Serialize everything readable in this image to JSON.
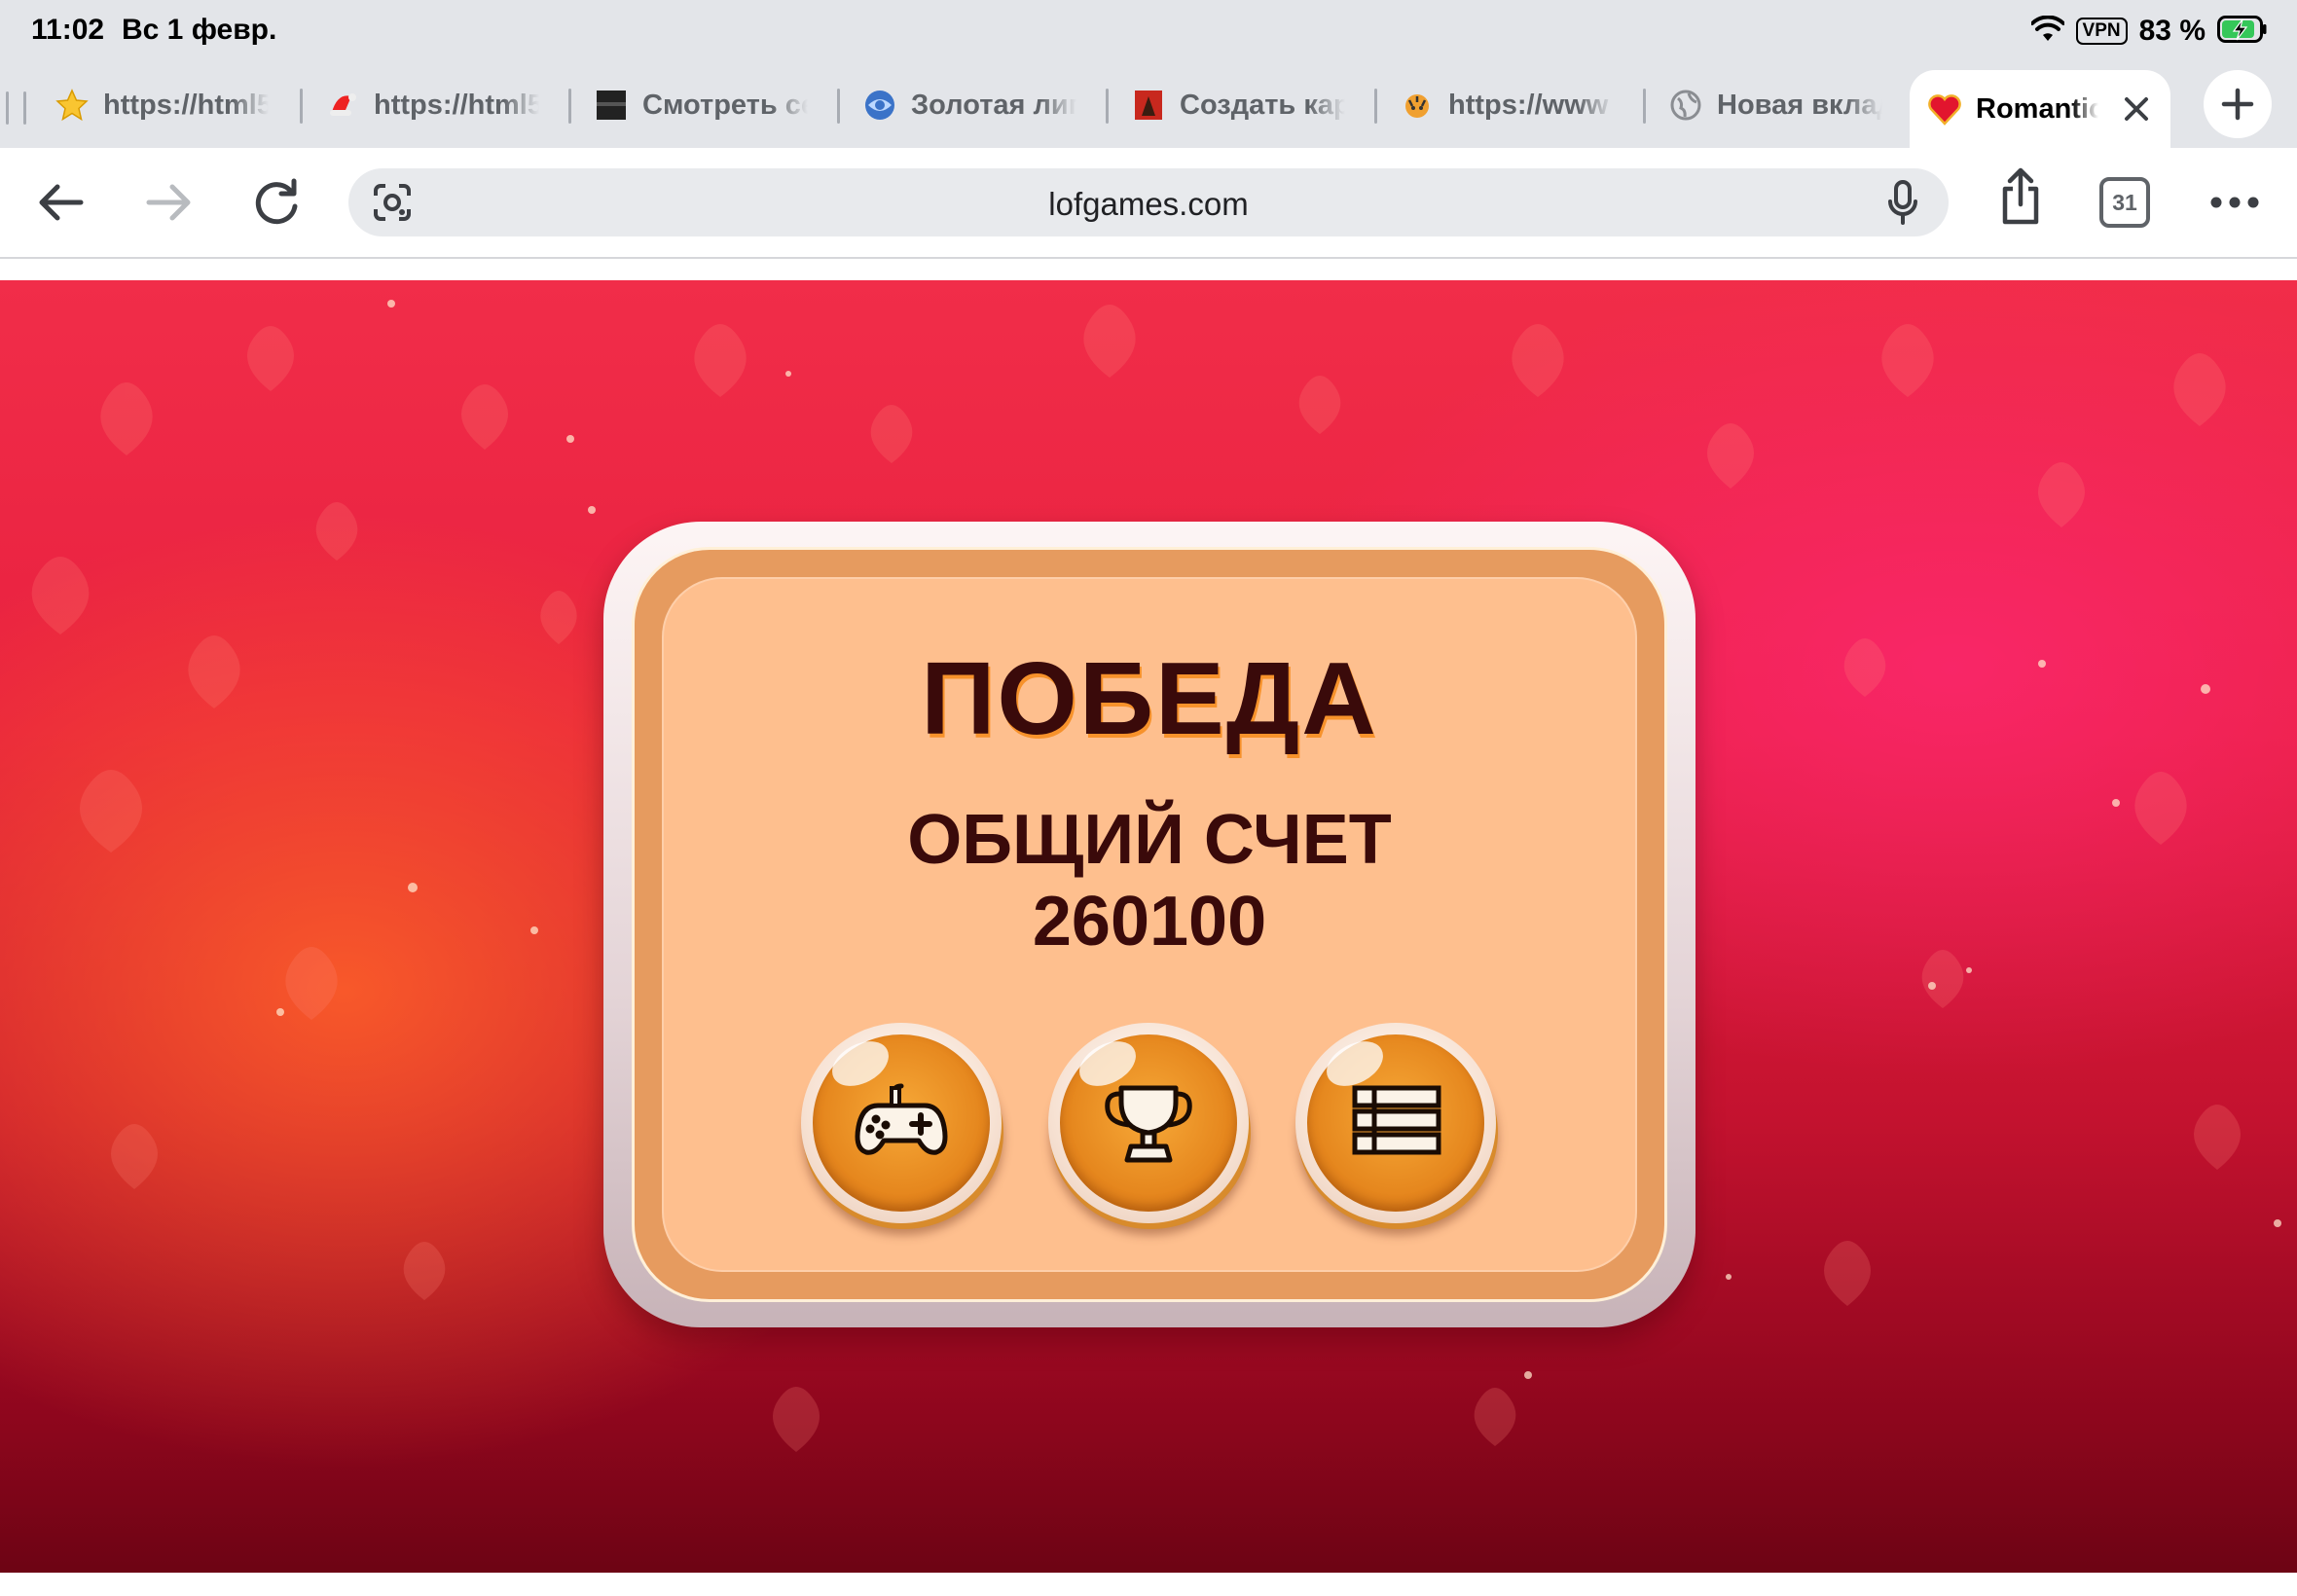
{
  "status_bar": {
    "time": "11:02",
    "date": "Вс 1 февр.",
    "vpn": "VPN",
    "battery": "83 %"
  },
  "tabs": [
    {
      "title": "https://html5",
      "icon": "star-favicon-icon"
    },
    {
      "title": "https://html5",
      "icon": "santa-hat-favicon-icon"
    },
    {
      "title": "Смотреть сериал",
      "icon": "dark-square-favicon-icon"
    },
    {
      "title": "Золотая лига",
      "icon": "blue-globe-favicon-icon"
    },
    {
      "title": "Создать карту",
      "icon": "red-poster-favicon-icon"
    },
    {
      "title": "https://www",
      "icon": "tiger-favicon-icon"
    },
    {
      "title": "Новая вкладка",
      "icon": "globe-favicon-icon"
    },
    {
      "title": "Romantic",
      "icon": "heart-favicon-icon",
      "active": true
    }
  ],
  "toolbar": {
    "url": "lofgames.com",
    "tab_count": "31"
  },
  "game": {
    "title": "ПОБЕДА",
    "score_label": "ОБЩИЙ СЧЕТ",
    "score_value": "260100",
    "buttons": [
      {
        "icon": "gamepad-icon"
      },
      {
        "icon": "trophy-icon"
      },
      {
        "icon": "menu-list-icon"
      }
    ]
  },
  "colors": {
    "dialog_inner": "#febf8e",
    "dialog_border": "#e69b5f",
    "title_text": "#3a0a0a",
    "button_orange": "#e5861d",
    "background_red": "#e8203f"
  }
}
